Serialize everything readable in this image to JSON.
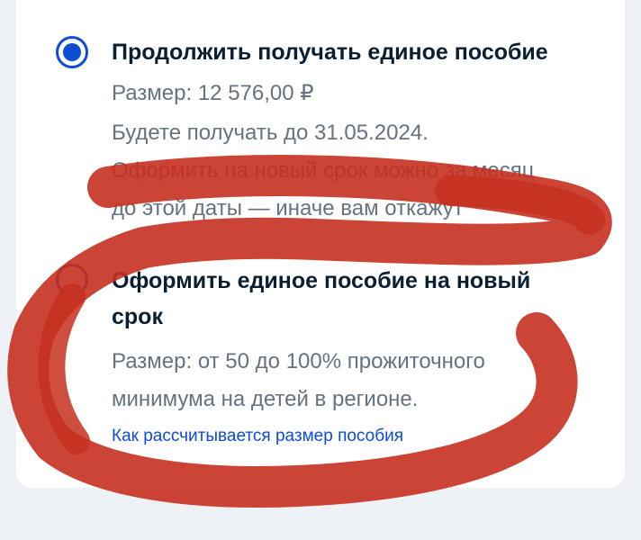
{
  "options": [
    {
      "selected": true,
      "title": "Продолжить получать единое пособие",
      "size_text": "Размер: 12 576,00 ₽",
      "lines": [
        "Будете получать до 31.05.2024.",
        "Оформить на новый срок можно за месяц",
        "до этой даты — иначе вам откажут"
      ]
    },
    {
      "selected": false,
      "title_line1": "Оформить единое пособие на новый",
      "title_line2": "срок",
      "lines": [
        "Размер: от 50 до 100% прожиточного",
        "минимума на детей в регионе."
      ],
      "link": "Как рассчитывается размер пособия"
    }
  ],
  "colors": {
    "accent": "#0d4cd3",
    "title": "#0b1f33",
    "text": "#66727f",
    "annotation": "#c5301f"
  }
}
